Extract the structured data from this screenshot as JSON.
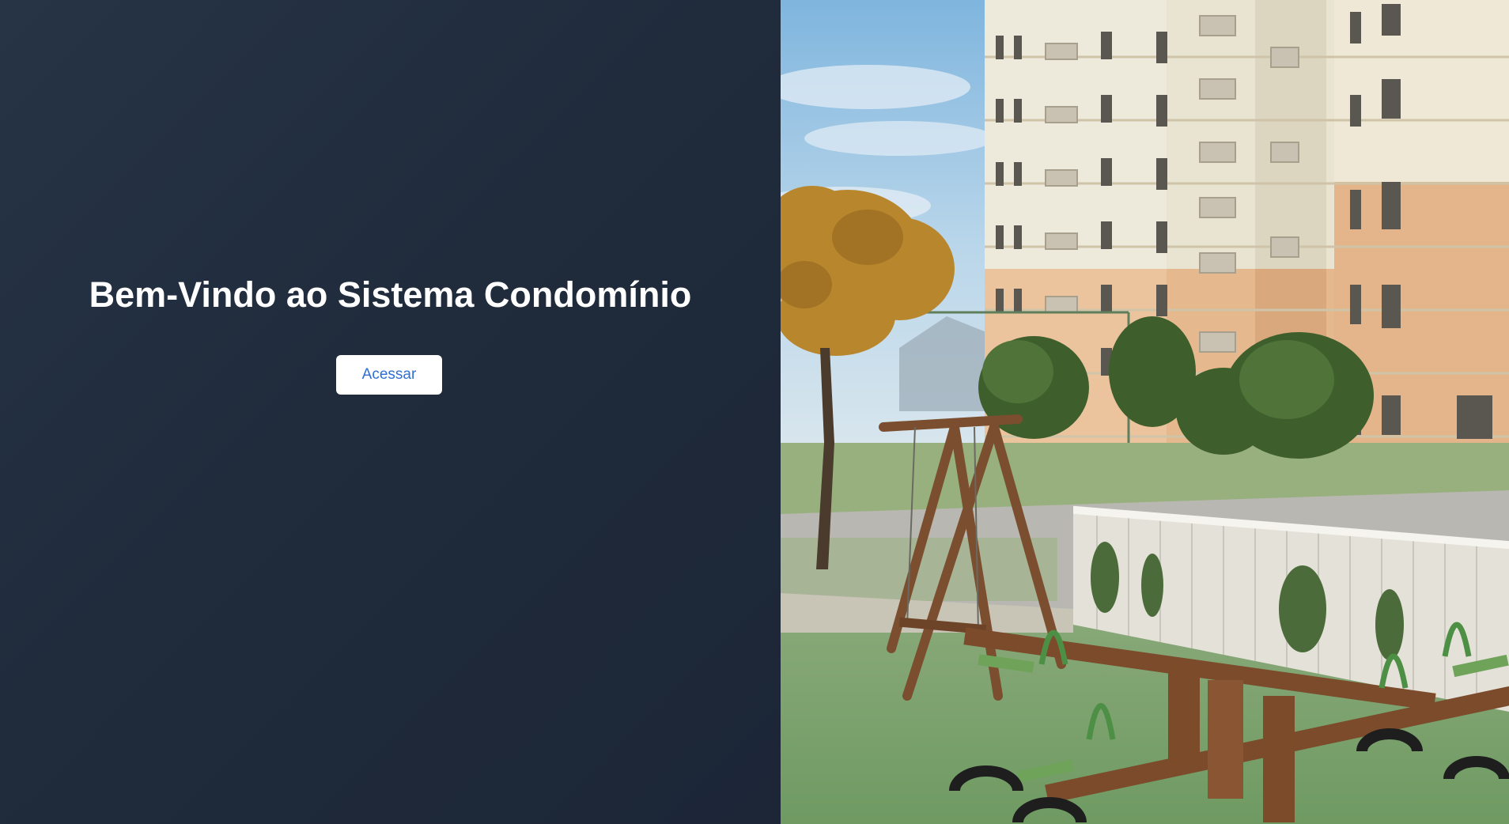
{
  "hero": {
    "title": "Bem-Vindo ao Sistema Condomínio",
    "access_label": "Acessar"
  },
  "colors": {
    "panel_bg": "#222e3f",
    "title_text": "#ffffff",
    "button_bg": "#ffffff",
    "button_text": "#2f6fd6"
  },
  "illustration": {
    "icon": "condominium-playground-image"
  }
}
